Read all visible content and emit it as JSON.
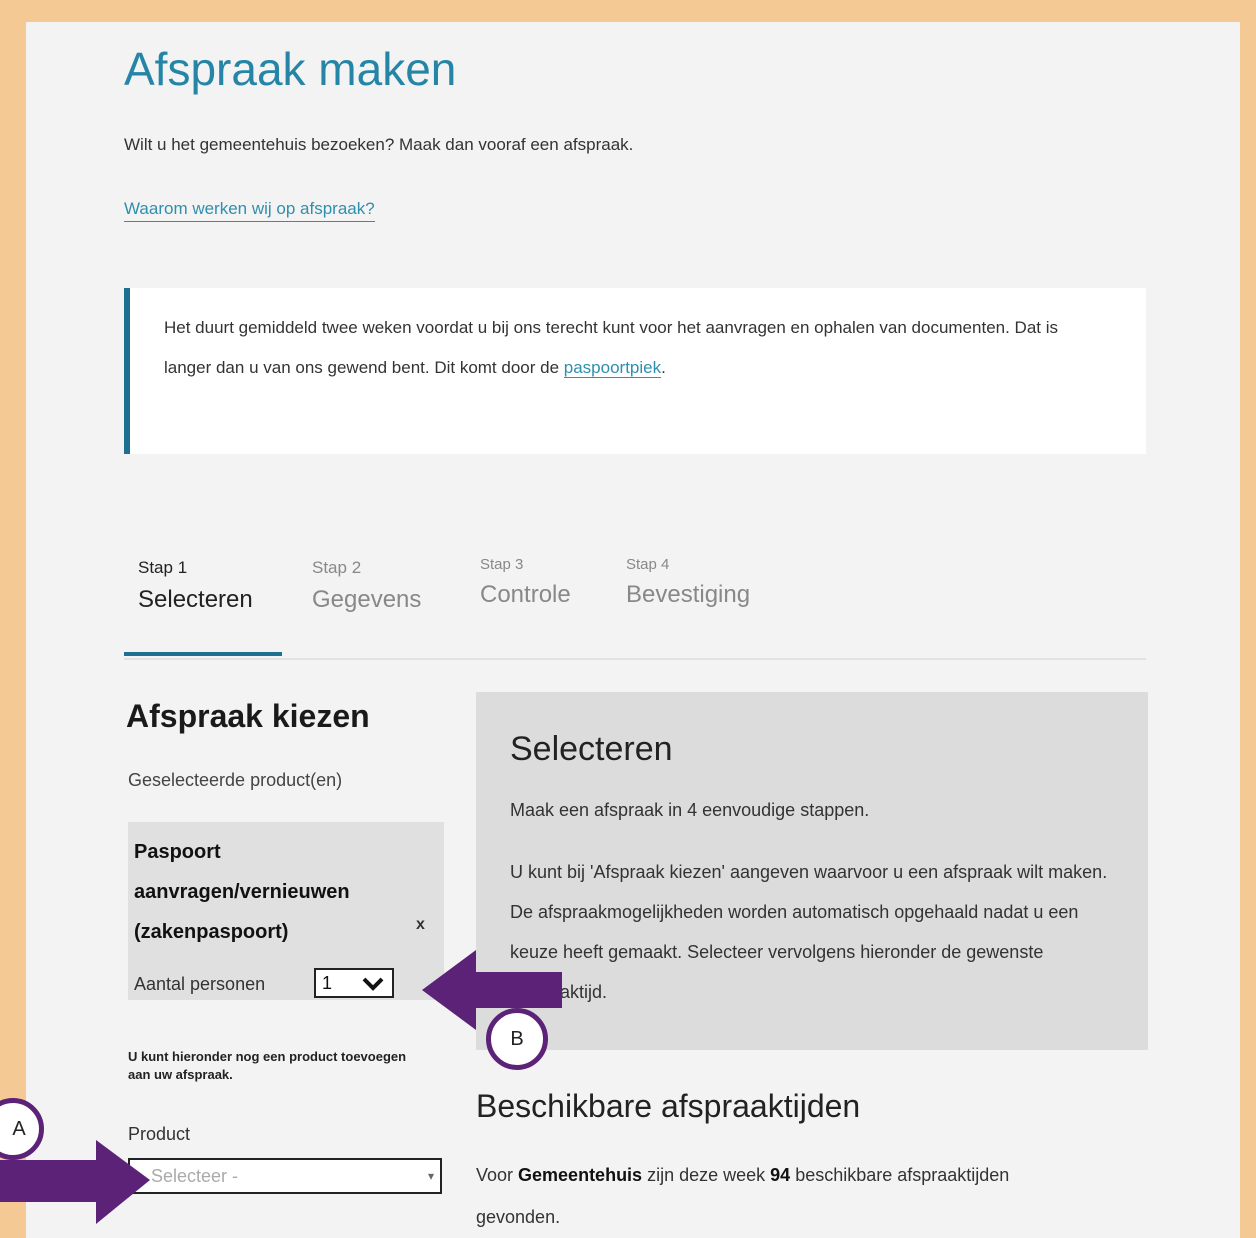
{
  "page": {
    "title": "Afspraak maken",
    "intro": "Wilt u het gemeentehuis bezoeken? Maak dan vooraf een afspraak.",
    "why_link": "Waarom werken wij op afspraak?"
  },
  "notice": {
    "text": "Het duurt gemiddeld twee weken voordat u bij ons terecht kunt voor het aanvragen en ophalen van documenten. Dat is langer dan u van ons gewend bent. Dit komt door de ",
    "link": "paspoortpiek",
    "suffix": "."
  },
  "steps": [
    {
      "num": "Stap 1",
      "label": "Selecteren"
    },
    {
      "num": "Stap 2",
      "label": "Gegevens"
    },
    {
      "num": "Stap 3",
      "label": "Controle"
    },
    {
      "num": "Stap 4",
      "label": "Bevestiging"
    }
  ],
  "sidebar": {
    "title": "Afspraak kiezen",
    "subtitle": "Geselecteerde product(en)",
    "product": {
      "name": "Paspoort aanvragen/vernieuwen (zakenpaspoort)",
      "remove": "x",
      "persons_label": "Aantal personen",
      "persons_value": "1"
    },
    "add_hint": "U kunt hieronder nog een product toevoegen aan uw afspraak.",
    "product_label": "Product",
    "product_placeholder": "- Selecteer -"
  },
  "info": {
    "title": "Selecteren",
    "p1": "Maak een afspraak in 4 eenvoudige stappen.",
    "p2": "U kunt bij 'Afspraak kiezen' aangeven waarvoor u een afspraak wilt maken. De afspraakmogelijkheden worden automatisch opgehaald nadat u een keuze heeft gemaakt. Selecteer vervolgens hieronder de gewenste afspraaktijd."
  },
  "availability": {
    "title": "Beschikbare afspraaktijden",
    "prefix": "Voor ",
    "location": "Gemeentehuis",
    "middle": " zijn deze week ",
    "count": "94",
    "suffix": " beschikbare afspraaktijden gevonden."
  },
  "annotations": {
    "a": "A",
    "b": "B",
    "arrow_color": "#5b2277"
  }
}
